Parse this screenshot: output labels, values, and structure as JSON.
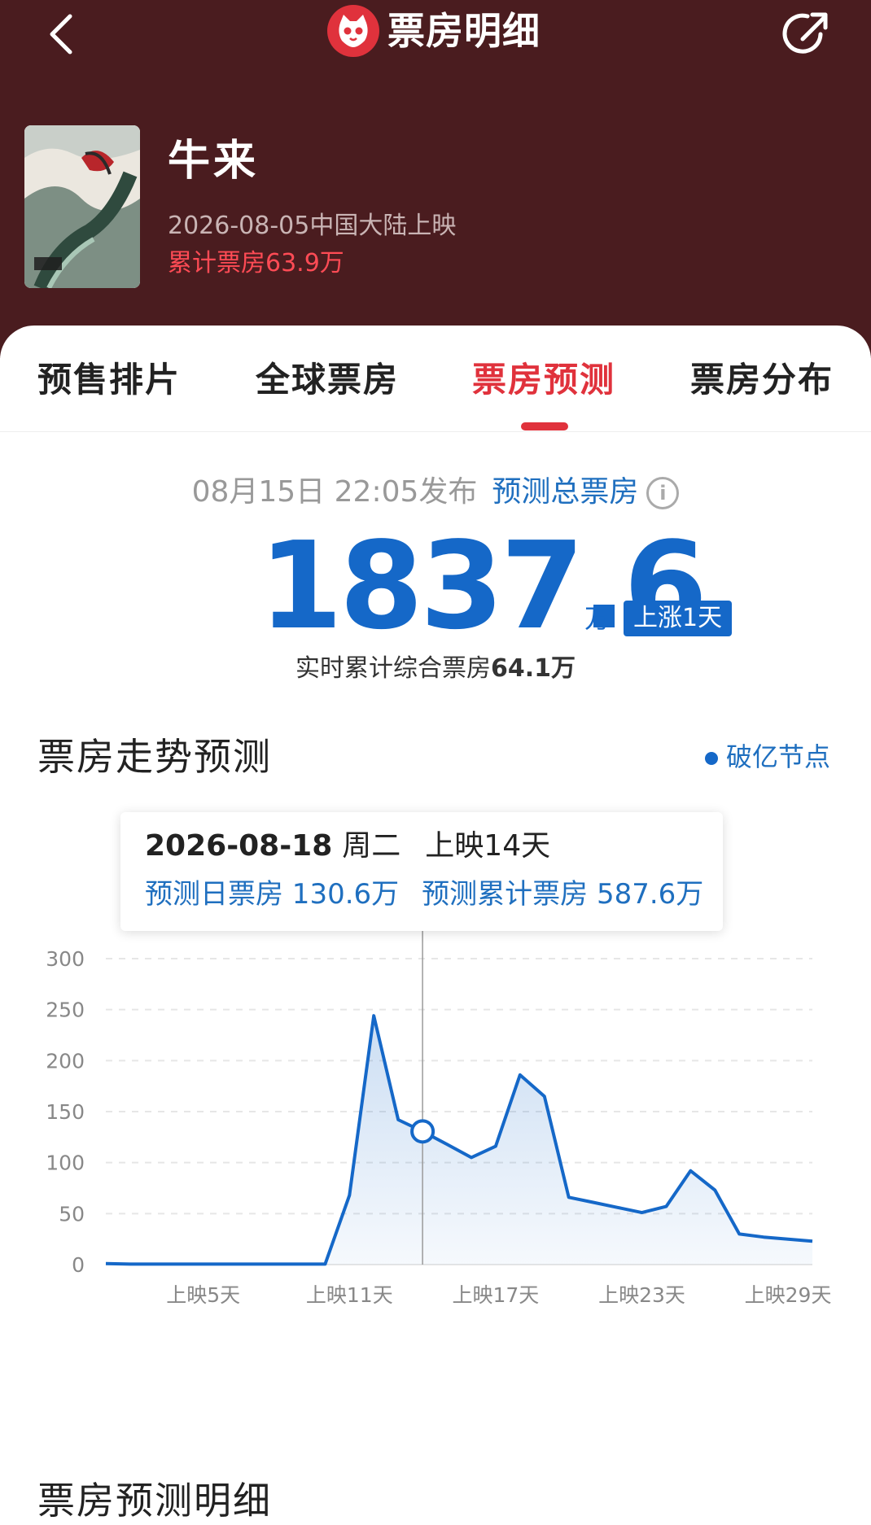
{
  "header": {
    "title": "票房明细",
    "movie": {
      "name": "牛来",
      "release": "2026-08-05中国大陆上映",
      "cumulative": "累计票房63.9万"
    },
    "colors": {
      "background": "#4a1c1f",
      "accent": "#e0323c"
    }
  },
  "tabs": [
    {
      "label": "预售排片"
    },
    {
      "label": "全球票房"
    },
    {
      "label": "票房预测",
      "active": true
    },
    {
      "label": "票房分布"
    }
  ],
  "prediction": {
    "publish_time": "08月15日 22:05发布",
    "total_label": "预测总票房",
    "value": "1837.6",
    "unit": "万",
    "badge": "上涨1天",
    "realtime_prefix": "实时累计综合票房",
    "realtime_value": "64.1万"
  },
  "trend": {
    "title": "票房走势预测",
    "legend_label": "破亿节点",
    "tooltip": {
      "date": "2026-08-18",
      "weekday": "周二",
      "day": "上映14天",
      "daily": "预测日票房 130.6万",
      "cumulative": "预测累计票房 587.6万"
    }
  },
  "detail_title": "票房预测明细",
  "chart_data": {
    "type": "area",
    "x": [
      1,
      2,
      3,
      4,
      5,
      6,
      7,
      8,
      9,
      10,
      11,
      12,
      13,
      14,
      15,
      16,
      17,
      18,
      19,
      20,
      21,
      22,
      23,
      24,
      25,
      26,
      27,
      28,
      29,
      30
    ],
    "values": [
      1,
      0.5,
      0.5,
      0.5,
      0.5,
      0.5,
      0.5,
      0.5,
      0.5,
      0.5,
      68,
      244,
      142,
      130.6,
      118,
      105,
      116,
      186,
      165,
      66,
      61,
      56,
      51,
      57,
      92,
      73,
      30,
      27,
      25,
      23
    ],
    "x_tick_labels": [
      {
        "x": 5,
        "label": "上映5天"
      },
      {
        "x": 11,
        "label": "上映11天"
      },
      {
        "x": 17,
        "label": "上映17天"
      },
      {
        "x": 23,
        "label": "上映23天"
      },
      {
        "x": 29,
        "label": "上映29天"
      }
    ],
    "y_ticks": [
      0,
      50,
      100,
      150,
      200,
      250,
      300
    ],
    "ylim": [
      0,
      300
    ],
    "xlim": [
      1,
      30
    ],
    "highlight_x": 14,
    "grid": true,
    "color": "#1568c8"
  }
}
